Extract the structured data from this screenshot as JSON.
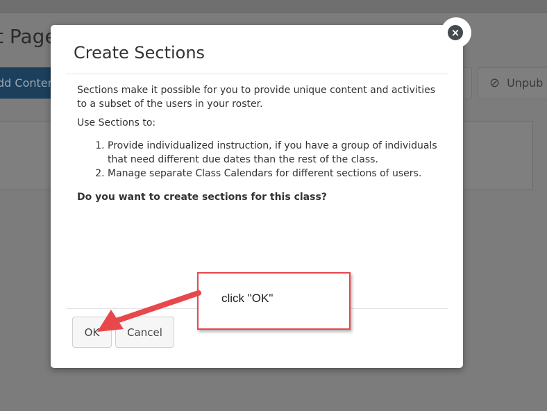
{
  "background": {
    "page_title_fragment": "t Page",
    "add_content_fragment": "dd Content",
    "unpublish_fragment": "Unpub"
  },
  "modal": {
    "title": "Create Sections",
    "intro": "Sections make it possible for you to provide unique content and activities to a subset of the users in your roster.",
    "use_heading": "Use Sections to:",
    "uses": [
      "Provide individualized instruction, if you have a group of individuals that need different due dates than the rest of the class.",
      "Manage separate Class Calendars for different sections of users."
    ],
    "question": "Do you want to create sections for this class?",
    "ok_label": "OK",
    "cancel_label": "Cancel",
    "close_symbol": "×"
  },
  "annotation": {
    "text": "click \"OK\"",
    "color": "#e8474b"
  }
}
